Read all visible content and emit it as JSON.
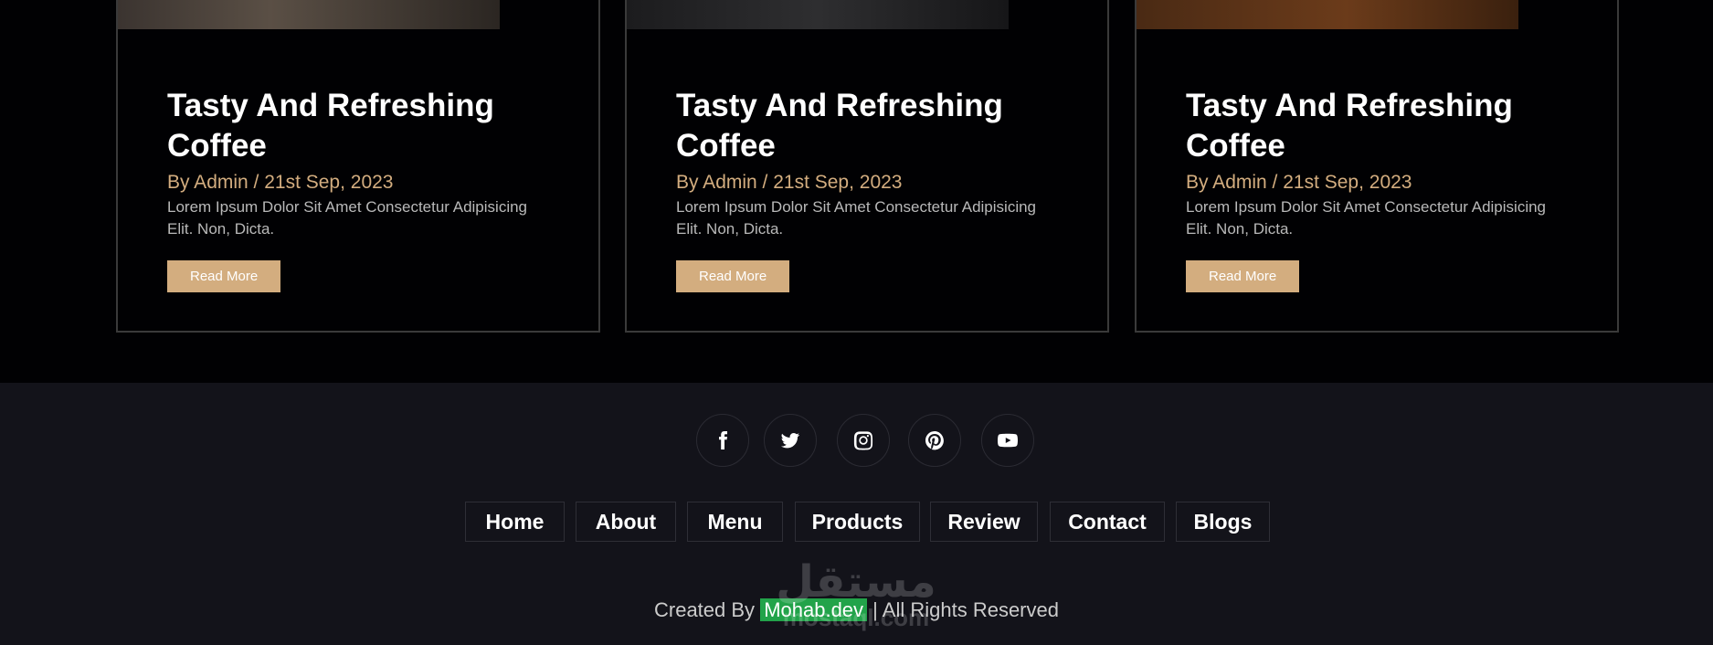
{
  "blog_cards": [
    {
      "title": "Tasty And Refreshing Coffee",
      "meta": "By Admin / 21st Sep, 2023",
      "excerpt": "Lorem Ipsum Dolor Sit Amet Consectetur Adipisicing Elit. Non, Dicta.",
      "button_label": "Read More"
    },
    {
      "title": "Tasty And Refreshing Coffee",
      "meta": "By Admin / 21st Sep, 2023",
      "excerpt": "Lorem Ipsum Dolor Sit Amet Consectetur Adipisicing Elit. Non, Dicta.",
      "button_label": "Read More"
    },
    {
      "title": "Tasty And Refreshing Coffee",
      "meta": "By Admin / 21st Sep, 2023",
      "excerpt": "Lorem Ipsum Dolor Sit Amet Consectetur Adipisicing Elit. Non, Dicta.",
      "button_label": "Read More"
    }
  ],
  "footer": {
    "social_icons": [
      "facebook-icon",
      "twitter-icon",
      "instagram-icon",
      "pinterest-icon",
      "youtube-icon"
    ],
    "links": [
      "Home",
      "About",
      "Menu",
      "Products",
      "Review",
      "Contact",
      "Blogs"
    ],
    "credit_prefix": "Created By",
    "credit_name": "Mohab.dev",
    "credit_suffix": "| All Rights Reserved"
  },
  "watermark": {
    "arabic": "مستقل",
    "latin": "mostaql.com"
  },
  "colors": {
    "accent": "#d3ad7f",
    "background": "#010103",
    "footer_background": "#13131a",
    "credit_highlight": "#22a34a"
  }
}
